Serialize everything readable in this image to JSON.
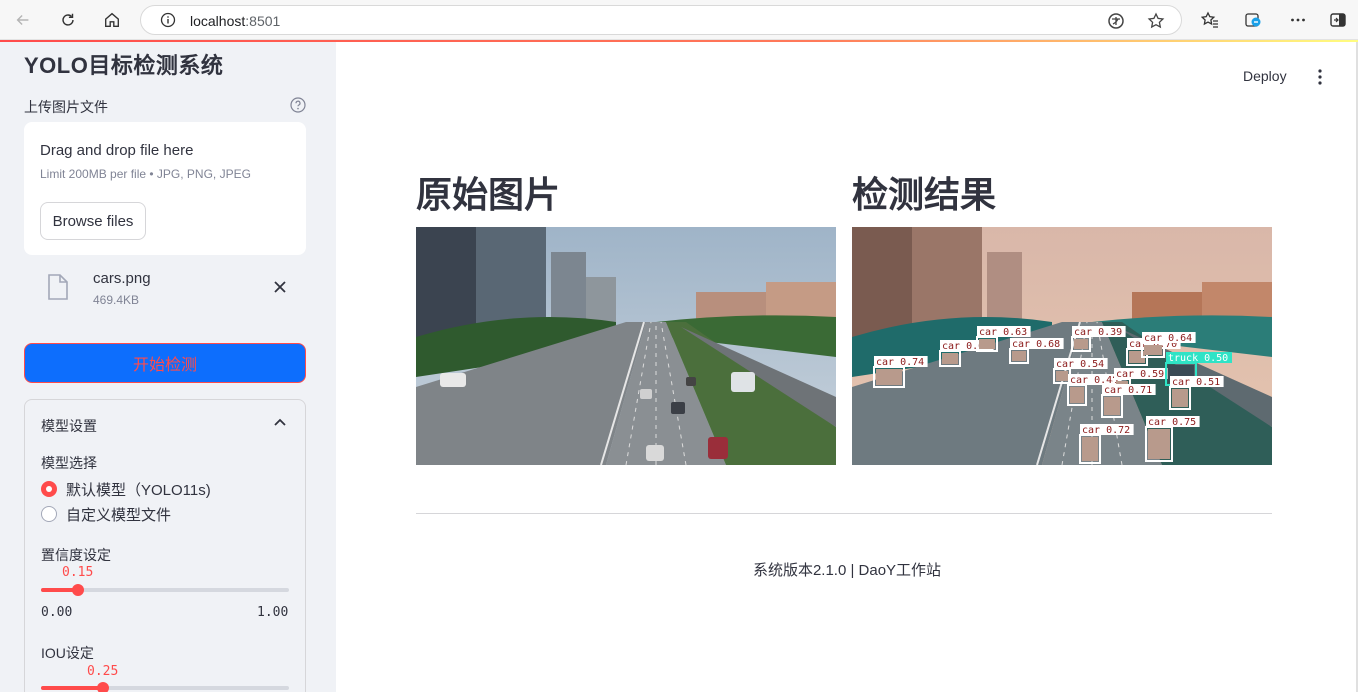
{
  "browser": {
    "url_host": "localhost",
    "url_port": ":8501"
  },
  "sidebar": {
    "title": "YOLO目标检测系统",
    "upload_label": "上传图片文件",
    "dropzone_main": "Drag and drop file here",
    "dropzone_sub": "Limit 200MB per file • JPG, PNG, JPEG",
    "browse_label": "Browse files",
    "file_name": "cars.png",
    "file_size": "469.4KB",
    "start_button": "开始检测",
    "settings_title": "模型设置",
    "model_label": "模型选择",
    "model_options": [
      "默认模型（YOLO11s)",
      "自定义模型文件"
    ],
    "model_selected_index": 0,
    "confidence": {
      "label": "置信度设定",
      "value_text": "0.15",
      "value": 0.15,
      "min": "0.00",
      "max": "1.00"
    },
    "iou": {
      "label": "IOU设定",
      "value_text": "0.25",
      "value": 0.25
    }
  },
  "main": {
    "deploy_label": "Deploy",
    "original_title": "原始图片",
    "result_title": "检测结果",
    "footer": "系统版本2.1.0 | DaoY工作站"
  },
  "detections": [
    {
      "label": "car 0.74",
      "cls": "car"
    },
    {
      "label": "car 0.66",
      "cls": "car"
    },
    {
      "label": "car 0.63",
      "cls": "car"
    },
    {
      "label": "car 0.68",
      "cls": "car"
    },
    {
      "label": "car 0.39",
      "cls": "car"
    },
    {
      "label": "car 0.70",
      "cls": "car"
    },
    {
      "label": "car 0.64",
      "cls": "car"
    },
    {
      "label": "car 0.54",
      "cls": "car"
    },
    {
      "label": "car 0.48",
      "cls": "car"
    },
    {
      "label": "car 0.59",
      "cls": "car"
    },
    {
      "label": "truck 0.50",
      "cls": "truck"
    },
    {
      "label": "car 0.71",
      "cls": "car"
    },
    {
      "label": "car 0.51",
      "cls": "car"
    },
    {
      "label": "car 0.72",
      "cls": "car"
    },
    {
      "label": "car 0.75",
      "cls": "car"
    }
  ],
  "colors": {
    "accent": "#ff4b4b",
    "start_button_bg": "#0d6efd",
    "sidebar_bg": "#f0f2f6",
    "car_box": "#ffffff",
    "car_label_bg": "#ffffff",
    "car_label_text": "#8b1a1a",
    "truck_label_bg": "#2fe3c6"
  }
}
